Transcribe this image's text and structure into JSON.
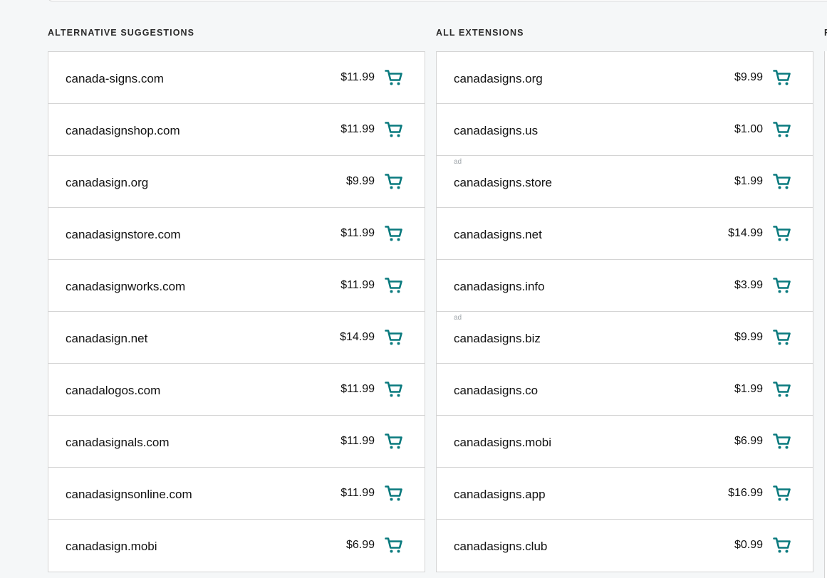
{
  "accent_color": "#0a7a7e",
  "cart_icon": "cart-icon",
  "columns": [
    {
      "header": "ALTERNATIVE SUGGESTIONS",
      "rows": [
        {
          "domain": "canada-signs.com",
          "price": "$11.99",
          "ad": ""
        },
        {
          "domain": "canadasignshop.com",
          "price": "$11.99",
          "ad": ""
        },
        {
          "domain": "canadasign.org",
          "price": "$9.99",
          "ad": ""
        },
        {
          "domain": "canadasignstore.com",
          "price": "$11.99",
          "ad": ""
        },
        {
          "domain": "canadasignworks.com",
          "price": "$11.99",
          "ad": ""
        },
        {
          "domain": "canadasign.net",
          "price": "$14.99",
          "ad": ""
        },
        {
          "domain": "canadalogos.com",
          "price": "$11.99",
          "ad": ""
        },
        {
          "domain": "canadasignals.com",
          "price": "$11.99",
          "ad": ""
        },
        {
          "domain": "canadasignsonline.com",
          "price": "$11.99",
          "ad": ""
        },
        {
          "domain": "canadasign.mobi",
          "price": "$6.99",
          "ad": ""
        }
      ]
    },
    {
      "header": "ALL EXTENSIONS",
      "rows": [
        {
          "domain": "canadasigns.org",
          "price": "$9.99",
          "ad": ""
        },
        {
          "domain": "canadasigns.us",
          "price": "$1.00",
          "ad": ""
        },
        {
          "domain": "canadasigns.store",
          "price": "$1.99",
          "ad": "ad"
        },
        {
          "domain": "canadasigns.net",
          "price": "$14.99",
          "ad": ""
        },
        {
          "domain": "canadasigns.info",
          "price": "$3.99",
          "ad": ""
        },
        {
          "domain": "canadasigns.biz",
          "price": "$9.99",
          "ad": "ad"
        },
        {
          "domain": "canadasigns.co",
          "price": "$1.99",
          "ad": ""
        },
        {
          "domain": "canadasigns.mobi",
          "price": "$6.99",
          "ad": ""
        },
        {
          "domain": "canadasigns.app",
          "price": "$16.99",
          "ad": ""
        },
        {
          "domain": "canadasigns.club",
          "price": "$0.99",
          "ad": ""
        }
      ]
    }
  ],
  "partial_column": {
    "header": "F"
  }
}
